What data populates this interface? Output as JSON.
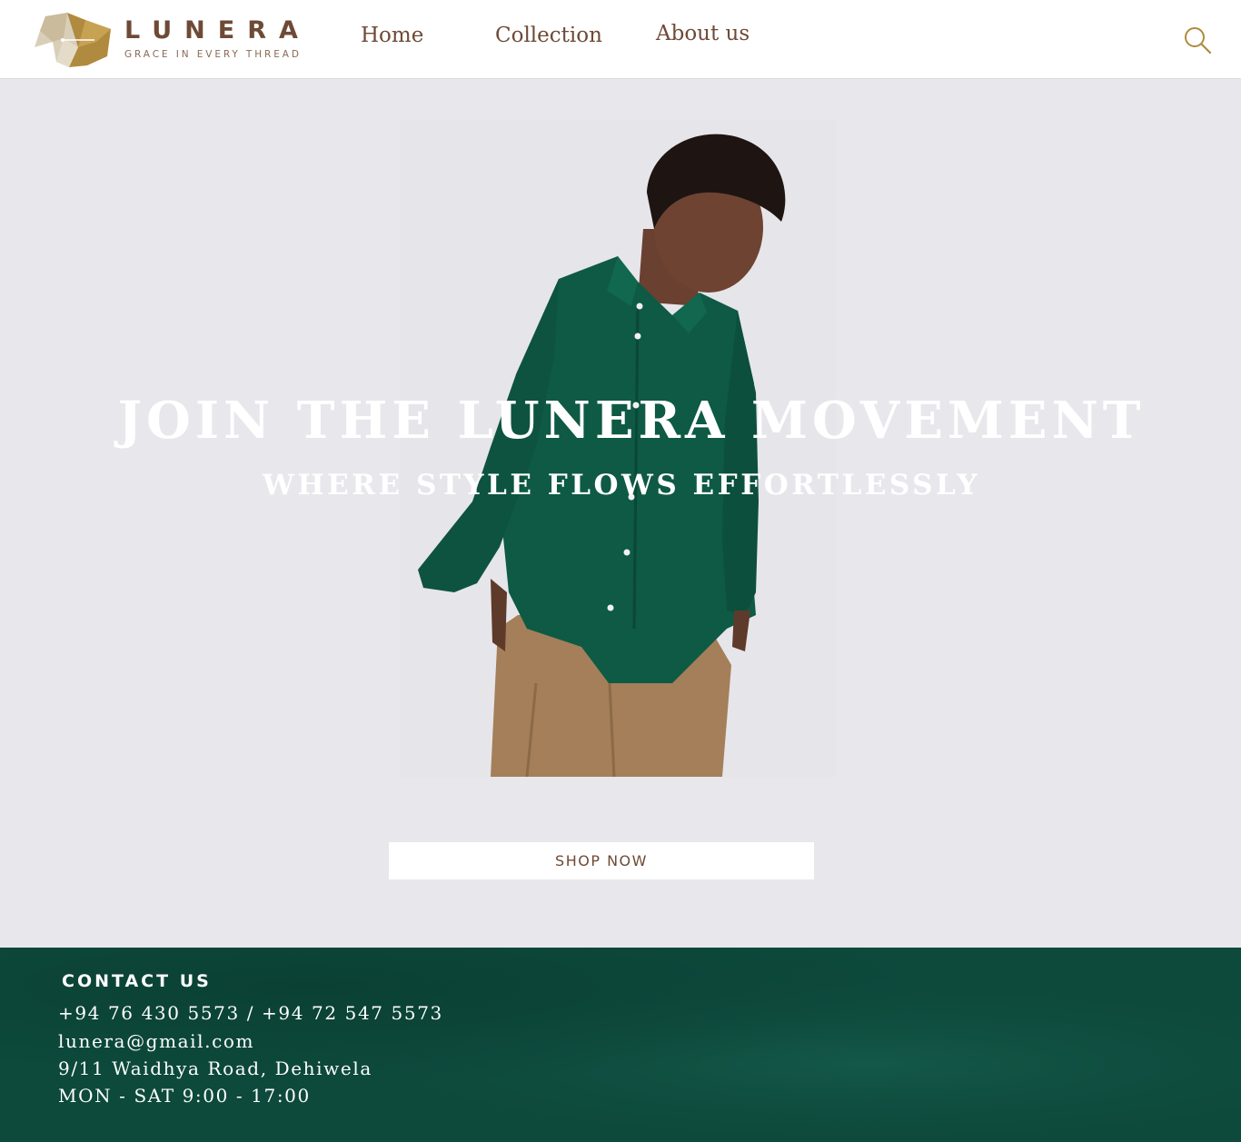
{
  "brand": {
    "name": "LUNERA",
    "tagline": "GRACE IN EVERY THREAD",
    "logo_icon": "origami-elephant-logo",
    "colors": {
      "primary": "#6e4a36",
      "accent": "#b08a3e",
      "footer_bg": "#0d4a3c",
      "hero_bg": "#e8e7ec"
    }
  },
  "nav": {
    "items": [
      {
        "label": "Home"
      },
      {
        "label": "Collection"
      },
      {
        "label": "About us"
      }
    ],
    "search_icon": "search-icon"
  },
  "hero": {
    "headline": "JOIN THE LUNERA MOVEMENT",
    "subheadline": "WHERE STYLE FLOWS EFFORTLESSLY",
    "cta_label": "SHOP NOW",
    "image": "model-in-green-shirt"
  },
  "footer": {
    "title": "CONTACT US",
    "phone": "+94 76 430 5573 / +94 72 547 5573",
    "email": "lunera@gmail.com",
    "address": "9/11 Waidhya Road, Dehiwela",
    "hours": "MON - SAT 9:00 - 17:00"
  }
}
